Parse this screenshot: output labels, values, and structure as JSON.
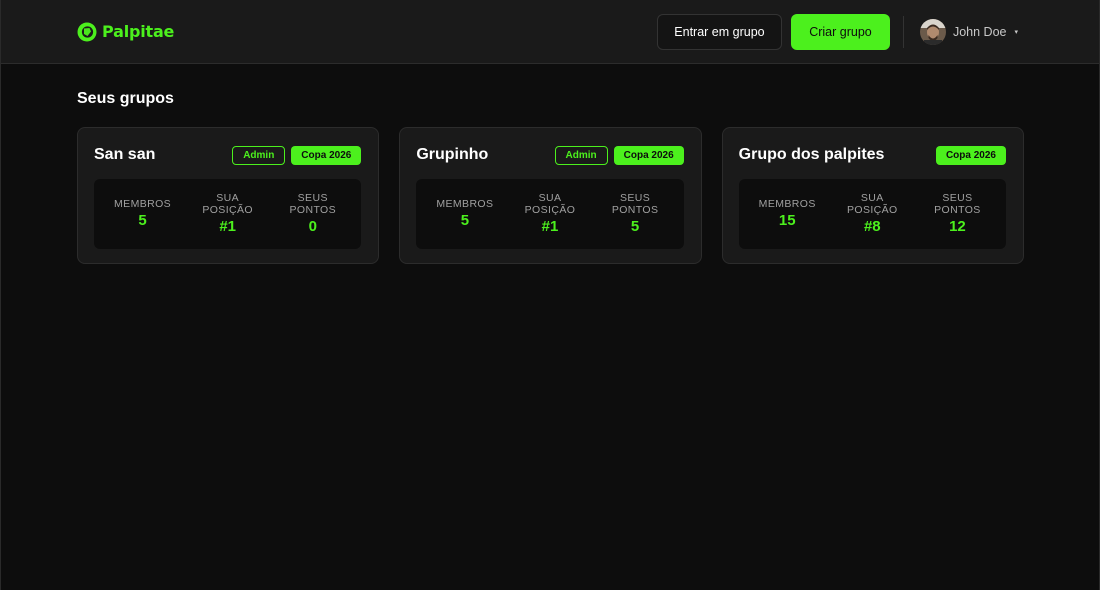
{
  "header": {
    "brand": "Palpitae",
    "join_label": "Entrar em grupo",
    "create_label": "Criar grupo",
    "user_name": "John Doe",
    "caret": "▾"
  },
  "main": {
    "section_title": "Seus grupos",
    "groups": [
      {
        "name": "San san",
        "admin_badge": "Admin",
        "tournament_badge": "Copa 2026",
        "stats": [
          {
            "label": "MEMBROS",
            "value": "5"
          },
          {
            "label": "SUA POSIÇÃO",
            "value": "#1"
          },
          {
            "label": "SEUS PONTOS",
            "value": "0"
          }
        ]
      },
      {
        "name": "Grupinho",
        "admin_badge": "Admin",
        "tournament_badge": "Copa 2026",
        "stats": [
          {
            "label": "MEMBROS",
            "value": "5"
          },
          {
            "label": "SUA POSIÇÃO",
            "value": "#1"
          },
          {
            "label": "SEUS PONTOS",
            "value": "5"
          }
        ]
      },
      {
        "name": "Grupo dos palpites",
        "tournament_badge": "Copa 2026",
        "stats": [
          {
            "label": "MEMBROS",
            "value": "15"
          },
          {
            "label": "SUA POSIÇÃO",
            "value": "#8"
          },
          {
            "label": "SEUS PONTOS",
            "value": "12"
          }
        ]
      }
    ]
  },
  "colors": {
    "accent": "#4cf01d",
    "background": "#0d0d0d",
    "surface": "#1a1a1a"
  },
  "icons": {
    "logo": "palpitae-logo-icon",
    "avatar": "user-avatar",
    "caret": "chevron-down-icon"
  }
}
